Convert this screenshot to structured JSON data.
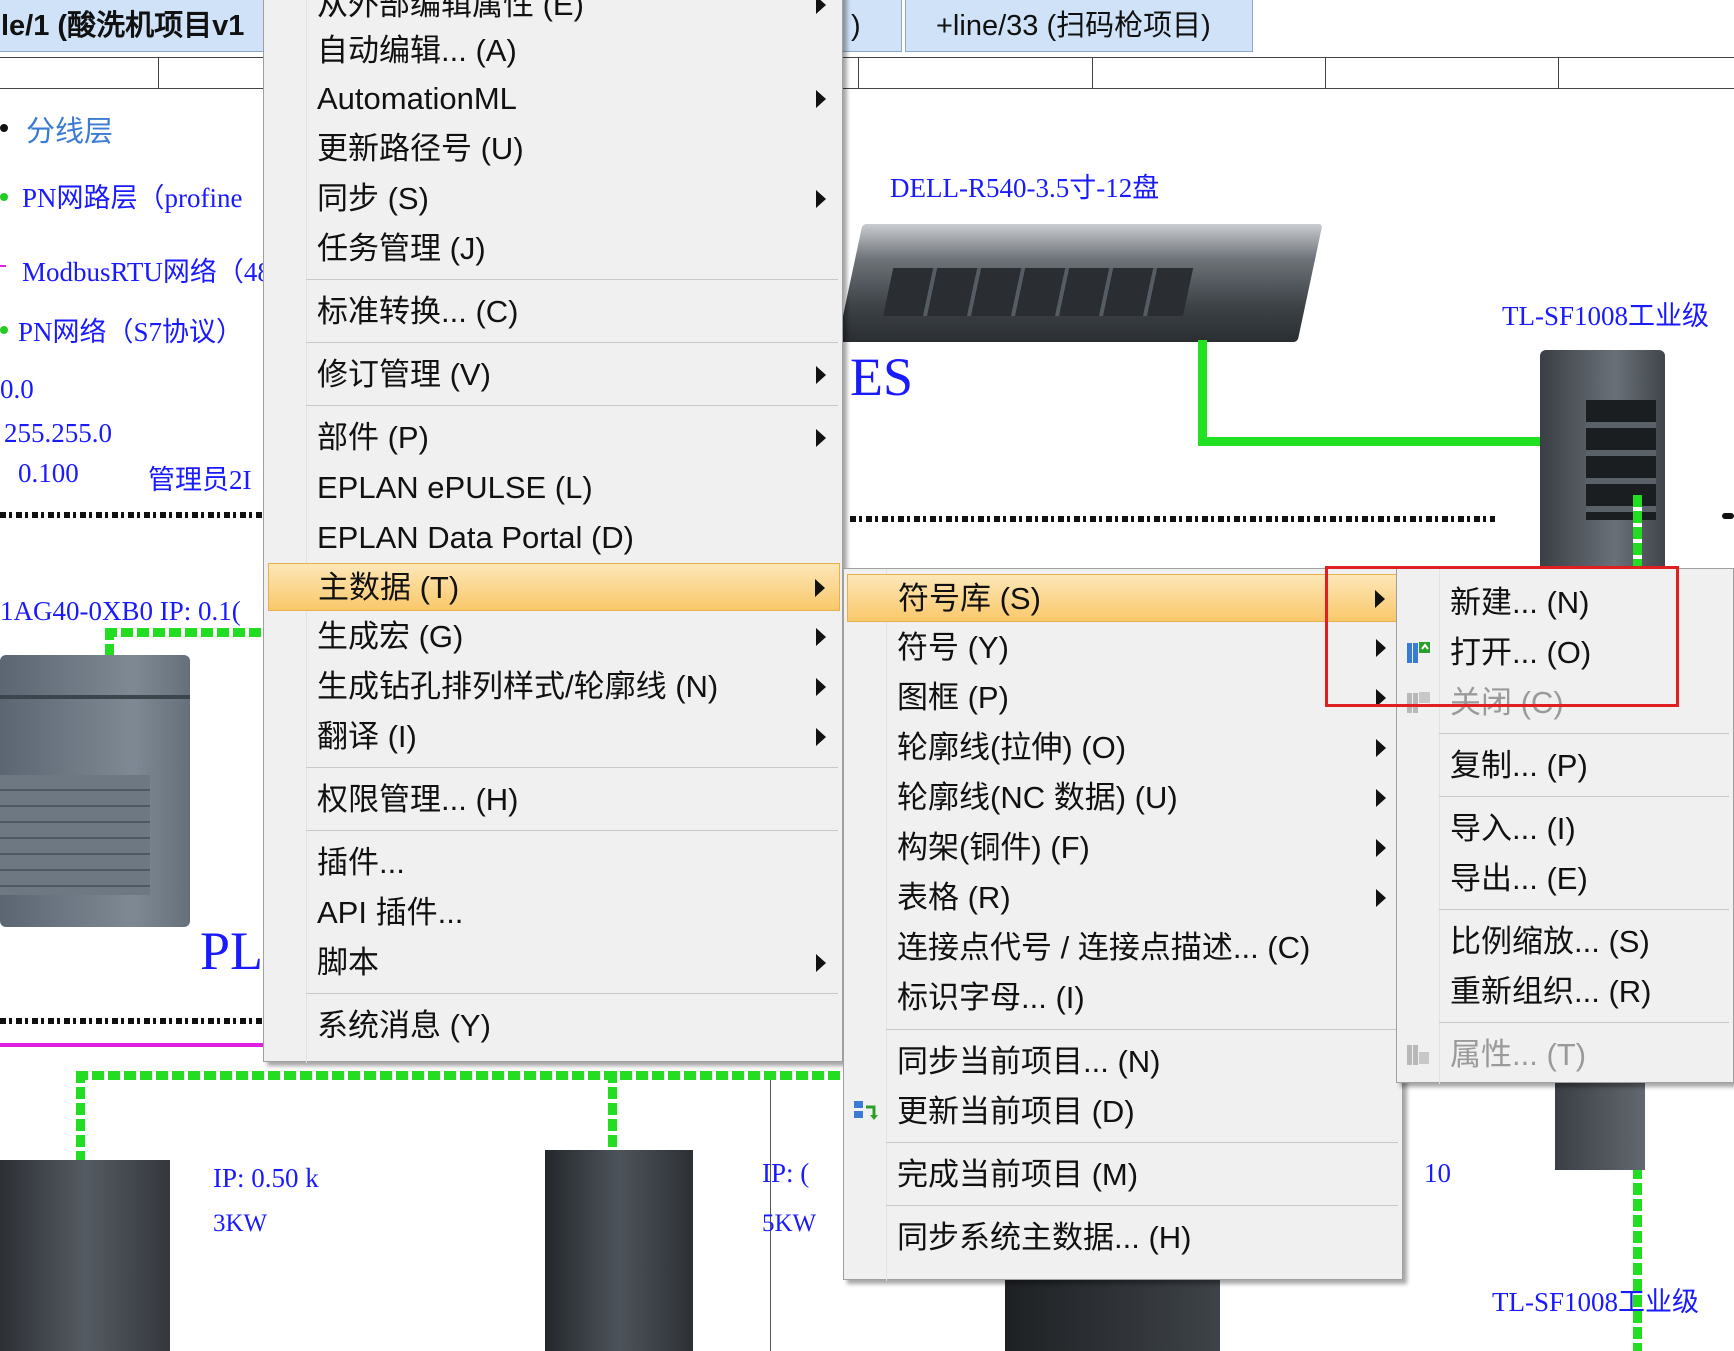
{
  "tabs": [
    {
      "label": "le/1 (酸洗机项目v1"
    },
    {
      "label": ")"
    },
    {
      "label": "+line/33 (扫码枪项目)"
    }
  ],
  "drawing": {
    "legend": [
      {
        "text": "分线层",
        "color": "#3a7bd5"
      },
      {
        "text": "PN网路层（profine",
        "color": "#1a1aff"
      },
      {
        "text": "ModbusRTU网络（48",
        "color": "#1a1aff"
      },
      {
        "text": "PN网络（S7协议）",
        "color": "#1a1aff"
      }
    ],
    "ip_lines": [
      "0.0",
      "255.255.0",
      "0.100",
      "管理员2I"
    ],
    "plc_label": "1AG40-0XB0 IP: 0.1(",
    "plc_big": "PL",
    "server_label": "DELL-R540-3.5寸-12盘",
    "mes_label": "ES",
    "switch_top_label": "TL-SF1008工业级",
    "switch_bottom_label": "TL-SF1008工业级",
    "drive1_ip": "IP: 0.50 k",
    "drive1_power": "3KW",
    "drive2_ip": "IP: (",
    "drive2_power": "5KW",
    "num_10": "10"
  },
  "menu1": {
    "items": [
      {
        "label": "从外部编辑属性 (E)",
        "submenu": true
      },
      {
        "label": "自动编辑... (A)",
        "submenu": false
      },
      {
        "label": "AutomationML",
        "submenu": true
      },
      {
        "label": "更新路径号 (U)",
        "submenu": false
      },
      {
        "label": "同步 (S)",
        "submenu": true
      },
      {
        "label": "任务管理 (J)",
        "submenu": false
      },
      {
        "label": "标准转换... (C)",
        "submenu": false
      },
      {
        "label": "修订管理 (V)",
        "submenu": true
      },
      {
        "label": "部件 (P)",
        "submenu": true
      },
      {
        "label": "EPLAN ePULSE (L)",
        "submenu": false
      },
      {
        "label": "EPLAN Data Portal (D)",
        "submenu": false
      },
      {
        "label": "主数据 (T)",
        "submenu": true
      },
      {
        "label": "生成宏 (G)",
        "submenu": true
      },
      {
        "label": "生成钻孔排列样式/轮廓线 (N)",
        "submenu": true
      },
      {
        "label": "翻译 (I)",
        "submenu": true
      },
      {
        "label": "权限管理... (H)",
        "submenu": false
      },
      {
        "label": "插件...",
        "submenu": false
      },
      {
        "label": "API 插件...",
        "submenu": false
      },
      {
        "label": "脚本",
        "submenu": true
      },
      {
        "label": "系统消息 (Y)",
        "submenu": false
      }
    ]
  },
  "menu2": {
    "items": [
      {
        "label": "符号库 (S)",
        "submenu": true
      },
      {
        "label": "符号 (Y)",
        "submenu": true
      },
      {
        "label": "图框 (P)",
        "submenu": true
      },
      {
        "label": "轮廓线(拉伸) (O)",
        "submenu": true
      },
      {
        "label": "轮廓线(NC 数据) (U)",
        "submenu": true
      },
      {
        "label": "构架(铜件) (F)",
        "submenu": true
      },
      {
        "label": "表格 (R)",
        "submenu": true
      },
      {
        "label": "连接点代号 / 连接点描述... (C)",
        "submenu": false
      },
      {
        "label": "标识字母... (I)",
        "submenu": false
      },
      {
        "label": "同步当前项目... (N)",
        "submenu": false
      },
      {
        "label": "更新当前项目 (D)",
        "submenu": false
      },
      {
        "label": "完成当前项目 (M)",
        "submenu": false
      },
      {
        "label": "同步系统主数据... (H)",
        "submenu": false
      }
    ]
  },
  "menu3": {
    "items": [
      {
        "label": "新建... (N)",
        "disabled": false
      },
      {
        "label": "打开... (O)",
        "disabled": false
      },
      {
        "label": "关闭 (C)",
        "disabled": true
      },
      {
        "label": "复制... (P)",
        "disabled": false
      },
      {
        "label": "导入... (I)",
        "disabled": false
      },
      {
        "label": "导出... (E)",
        "disabled": false
      },
      {
        "label": "比例缩放... (S)",
        "disabled": false
      },
      {
        "label": "重新组织... (R)",
        "disabled": false
      },
      {
        "label": "属性... (T)",
        "disabled": true
      }
    ]
  },
  "colors": {
    "highlight_box": "#e02020",
    "menu_highlight": "#f9c86a",
    "network_green": "#22e022",
    "magenta_line": "#e020e0"
  }
}
